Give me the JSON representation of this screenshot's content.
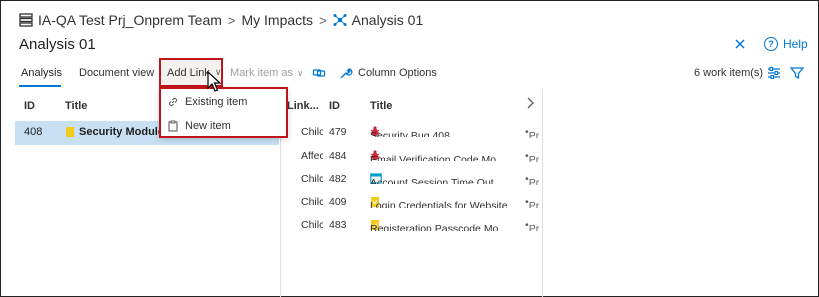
{
  "breadcrumb": {
    "project": "IA-QA Test Prj_Onprem Team",
    "section": "My Impacts",
    "current": "Analysis 01"
  },
  "page": {
    "title": "Analysis 01"
  },
  "header": {
    "help_label": "Help"
  },
  "toolbar": {
    "tab_analysis": "Analysis",
    "tab_document": "Document view",
    "add_link": "Add Link",
    "mark_item": "Mark item as",
    "column_options": "Column Options",
    "count": "6 work item(s)"
  },
  "add_link_menu": {
    "existing": "Existing item",
    "new": "New item"
  },
  "left_table": {
    "columns": {
      "id": "ID",
      "title": "Title"
    },
    "rows": [
      {
        "id": "408",
        "title": "Security Module fo"
      }
    ]
  },
  "right_table": {
    "columns": {
      "link": "Link...",
      "id": "ID",
      "title": "Title"
    },
    "rows": [
      {
        "link": "Chilc",
        "id": "479",
        "title": "Security Bug 408",
        "type": "bug",
        "state": "Pr"
      },
      {
        "link": "Affec",
        "id": "484",
        "title": "Email Verification Code Mo...",
        "type": "bug",
        "state": "Pr"
      },
      {
        "link": "Chilc",
        "id": "482",
        "title": "Account Session Time Out",
        "type": "task",
        "state": "Pr"
      },
      {
        "link": "Chilc",
        "id": "409",
        "title": "Login Credentials for Website",
        "type": "story",
        "state": "Pr"
      },
      {
        "link": "Chilc",
        "id": "483",
        "title": "Registeration Passcode Mo...",
        "type": "story",
        "state": "Pr"
      }
    ]
  },
  "colors": {
    "accent": "#0078d4",
    "highlight": "#c0141a",
    "selected_row": "#c7e0f4",
    "bug": "#cc293d",
    "story": "#f2cb1d",
    "task": "#009ccc"
  }
}
